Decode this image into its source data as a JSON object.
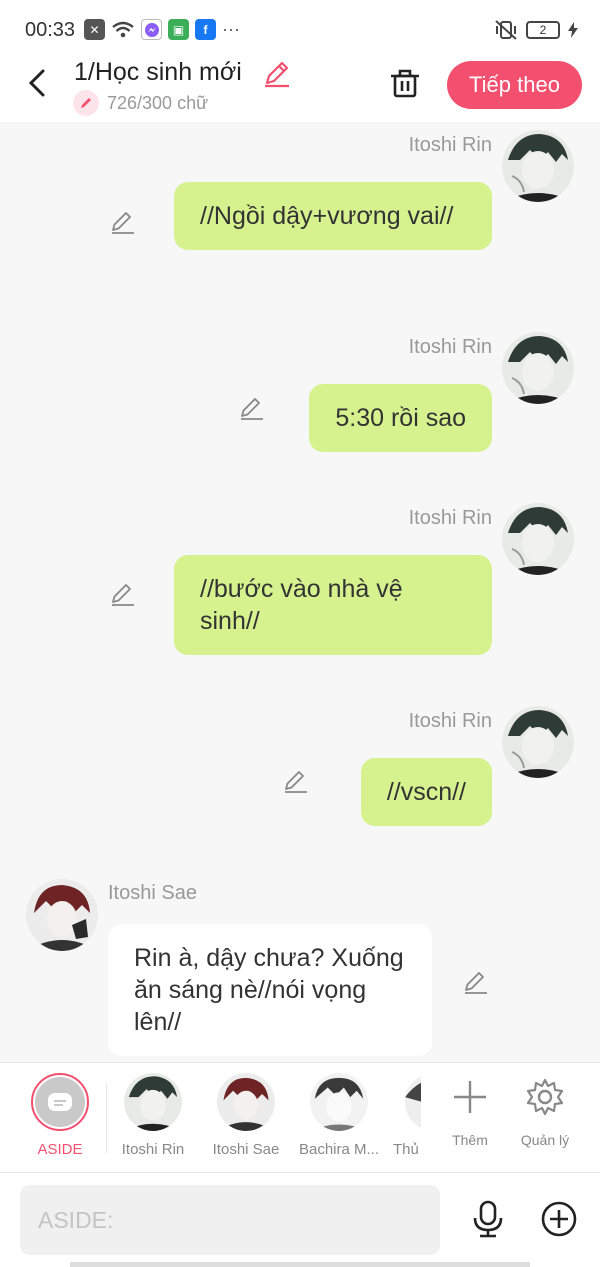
{
  "status_bar": {
    "time": "00:33",
    "battery": "2",
    "icons": [
      "close-box-icon",
      "wifi-icon",
      "messenger-icon",
      "notification-icon",
      "facebook-icon",
      "more-icon"
    ],
    "right_icons": [
      "mute-vibrate-icon",
      "battery-icon",
      "charging-icon"
    ]
  },
  "header": {
    "title": "1/Học sinh mới",
    "word_count": "726/300 chữ",
    "next_label": "Tiếp theo"
  },
  "chat": {
    "messages": [
      {
        "side": "right",
        "sender": "Itoshi Rin",
        "text": "//Ngồi dậy+vương vai//"
      },
      {
        "side": "right",
        "sender": "Itoshi Rin",
        "text": "5:30 rồi sao"
      },
      {
        "side": "right",
        "sender": "Itoshi Rin",
        "text": "//bước vào nhà vệ sinh//"
      },
      {
        "side": "right",
        "sender": "Itoshi Rin",
        "text": "//vscn//"
      },
      {
        "side": "left",
        "sender": "Itoshi Sae",
        "text": "Rin à, dậy chưa? Xuống ăn sáng nè//nói vọng lên//"
      }
    ]
  },
  "character_bar": {
    "items": [
      {
        "label": "ASIDE",
        "active": true
      },
      {
        "label": "Itoshi Rin"
      },
      {
        "label": "Itoshi Sae"
      },
      {
        "label": "Bachira M..."
      },
      {
        "label": "Thủ"
      }
    ],
    "add_label": "Thêm",
    "manage_label": "Quản lý"
  },
  "input": {
    "placeholder": "ASIDE:"
  },
  "colors": {
    "accent": "#f2506e",
    "bubble_right": "#d6f28e",
    "bubble_left": "#ffffff",
    "background": "#f7f7f7"
  }
}
